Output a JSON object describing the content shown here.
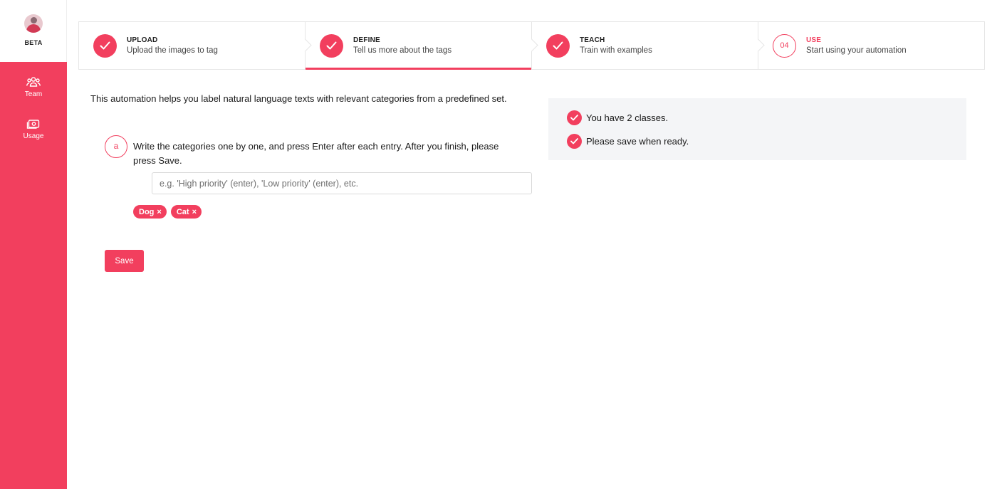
{
  "sidebar": {
    "badge": "BETA",
    "items": [
      {
        "label": "Team",
        "icon": "team-icon"
      },
      {
        "label": "Usage",
        "icon": "usage-icon"
      }
    ]
  },
  "steps": [
    {
      "title": "UPLOAD",
      "description": "Upload the images to tag",
      "state": "done"
    },
    {
      "title": "DEFINE",
      "description": "Tell us more about the tags",
      "state": "active"
    },
    {
      "title": "TEACH",
      "description": "Train with examples",
      "state": "done"
    },
    {
      "title": "USE",
      "number": "04",
      "description": "Start using your automation",
      "state": "pending"
    }
  ],
  "main": {
    "intro": "This automation helps you label natural language texts with relevant categories from a predefined set.",
    "step_letter": "a",
    "instruction": "Write the categories one by one, and press Enter after each entry. After you finish, please press Save.",
    "input": {
      "value": "",
      "placeholder": "e.g. 'High priority' (enter), 'Low priority' (enter), etc."
    },
    "tags": [
      {
        "label": "Dog",
        "remove": "×"
      },
      {
        "label": "Cat",
        "remove": "×"
      }
    ],
    "save_label": "Save"
  },
  "status": {
    "items": [
      "You have 2 classes.",
      "Please save when ready."
    ]
  },
  "colors": {
    "accent": "#f23f5e",
    "panel": "#f4f5f7"
  }
}
